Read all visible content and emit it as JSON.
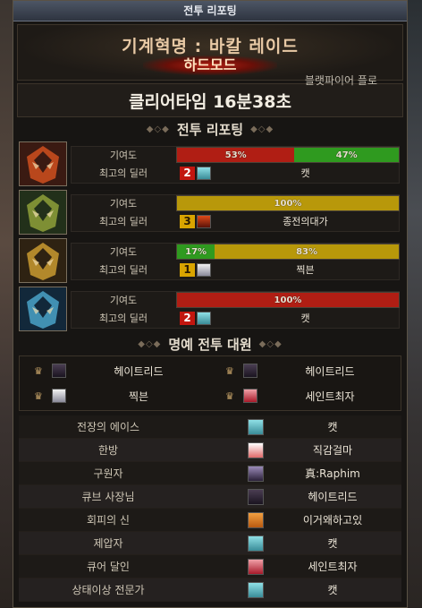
{
  "window": {
    "title": "전투 리포팅"
  },
  "header": {
    "raid_name": "기계혁명 : 바칼 레이드",
    "difficulty": "하드모드",
    "overlay_text": "블랫파이어 플로"
  },
  "clear_time": "클리어타임  16분38초",
  "sections": {
    "report": "전투 리포팅",
    "honor": "명예 전투 대원"
  },
  "labels": {
    "contribution": "기여도",
    "best_dealer": "최고의 딜러"
  },
  "colors": {
    "red": "#b01e14",
    "green": "#2f9a1f",
    "gold": "#b8980a"
  },
  "parties": [
    {
      "icon": "red-mech-helm-icon",
      "bars": [
        {
          "label": "53%",
          "value": 53,
          "color": "red"
        },
        {
          "label": "47%",
          "value": 47,
          "color": "green"
        }
      ],
      "dealer": {
        "rank": "2",
        "rank_color": "red",
        "avatar": "teal-hair-avatar",
        "name": "캣"
      }
    },
    {
      "icon": "green-mech-helm-icon",
      "bars": [
        {
          "label": "100%",
          "value": 100,
          "color": "gold"
        }
      ],
      "dealer": {
        "rank": "3",
        "rank_color": "yellow",
        "avatar": "red-fire-avatar",
        "name": "종전의대가"
      }
    },
    {
      "icon": "gold-mech-helm-icon",
      "bars": [
        {
          "label": "17%",
          "value": 17,
          "color": "green"
        },
        {
          "label": "83%",
          "value": 83,
          "color": "gold"
        }
      ],
      "dealer": {
        "rank": "1",
        "rank_color": "yellow",
        "avatar": "silver-hair-avatar",
        "name": "찍븐"
      }
    },
    {
      "icon": "blue-mech-helm-icon",
      "bars": [
        {
          "label": "100%",
          "value": 100,
          "color": "red"
        }
      ],
      "dealer": {
        "rank": "2",
        "rank_color": "red",
        "avatar": "teal-hair-avatar",
        "name": "캣"
      }
    }
  ],
  "honor": [
    {
      "avatar": "dark-armor-avatar",
      "name": "헤이트리드"
    },
    {
      "avatar": "dark-armor-avatar",
      "name": "헤이트리드"
    },
    {
      "avatar": "silver-hair-avatar",
      "name": "찍븐"
    },
    {
      "avatar": "red-pink-avatar",
      "name": "세인트최자"
    }
  ],
  "awards": [
    {
      "title": "전장의 에이스",
      "avatar": "teal-hair-avatar",
      "name": "캣"
    },
    {
      "title": "한방",
      "avatar": "white-red-avatar",
      "name": "직감걸마"
    },
    {
      "title": "구원자",
      "avatar": "purple-dark-avatar",
      "name": "真:Raphim"
    },
    {
      "title": "큐브 사장님",
      "avatar": "dark-armor-avatar",
      "name": "헤이트리드"
    },
    {
      "title": "회피의 신",
      "avatar": "orange-mask-avatar",
      "name": "이거왜하고있"
    },
    {
      "title": "제압자",
      "avatar": "teal-hair-avatar",
      "name": "캣"
    },
    {
      "title": "큐어 달인",
      "avatar": "red-pink-avatar",
      "name": "세인트최자"
    },
    {
      "title": "상태이상 전문가",
      "avatar": "teal-hair-avatar",
      "name": "캣"
    }
  ]
}
